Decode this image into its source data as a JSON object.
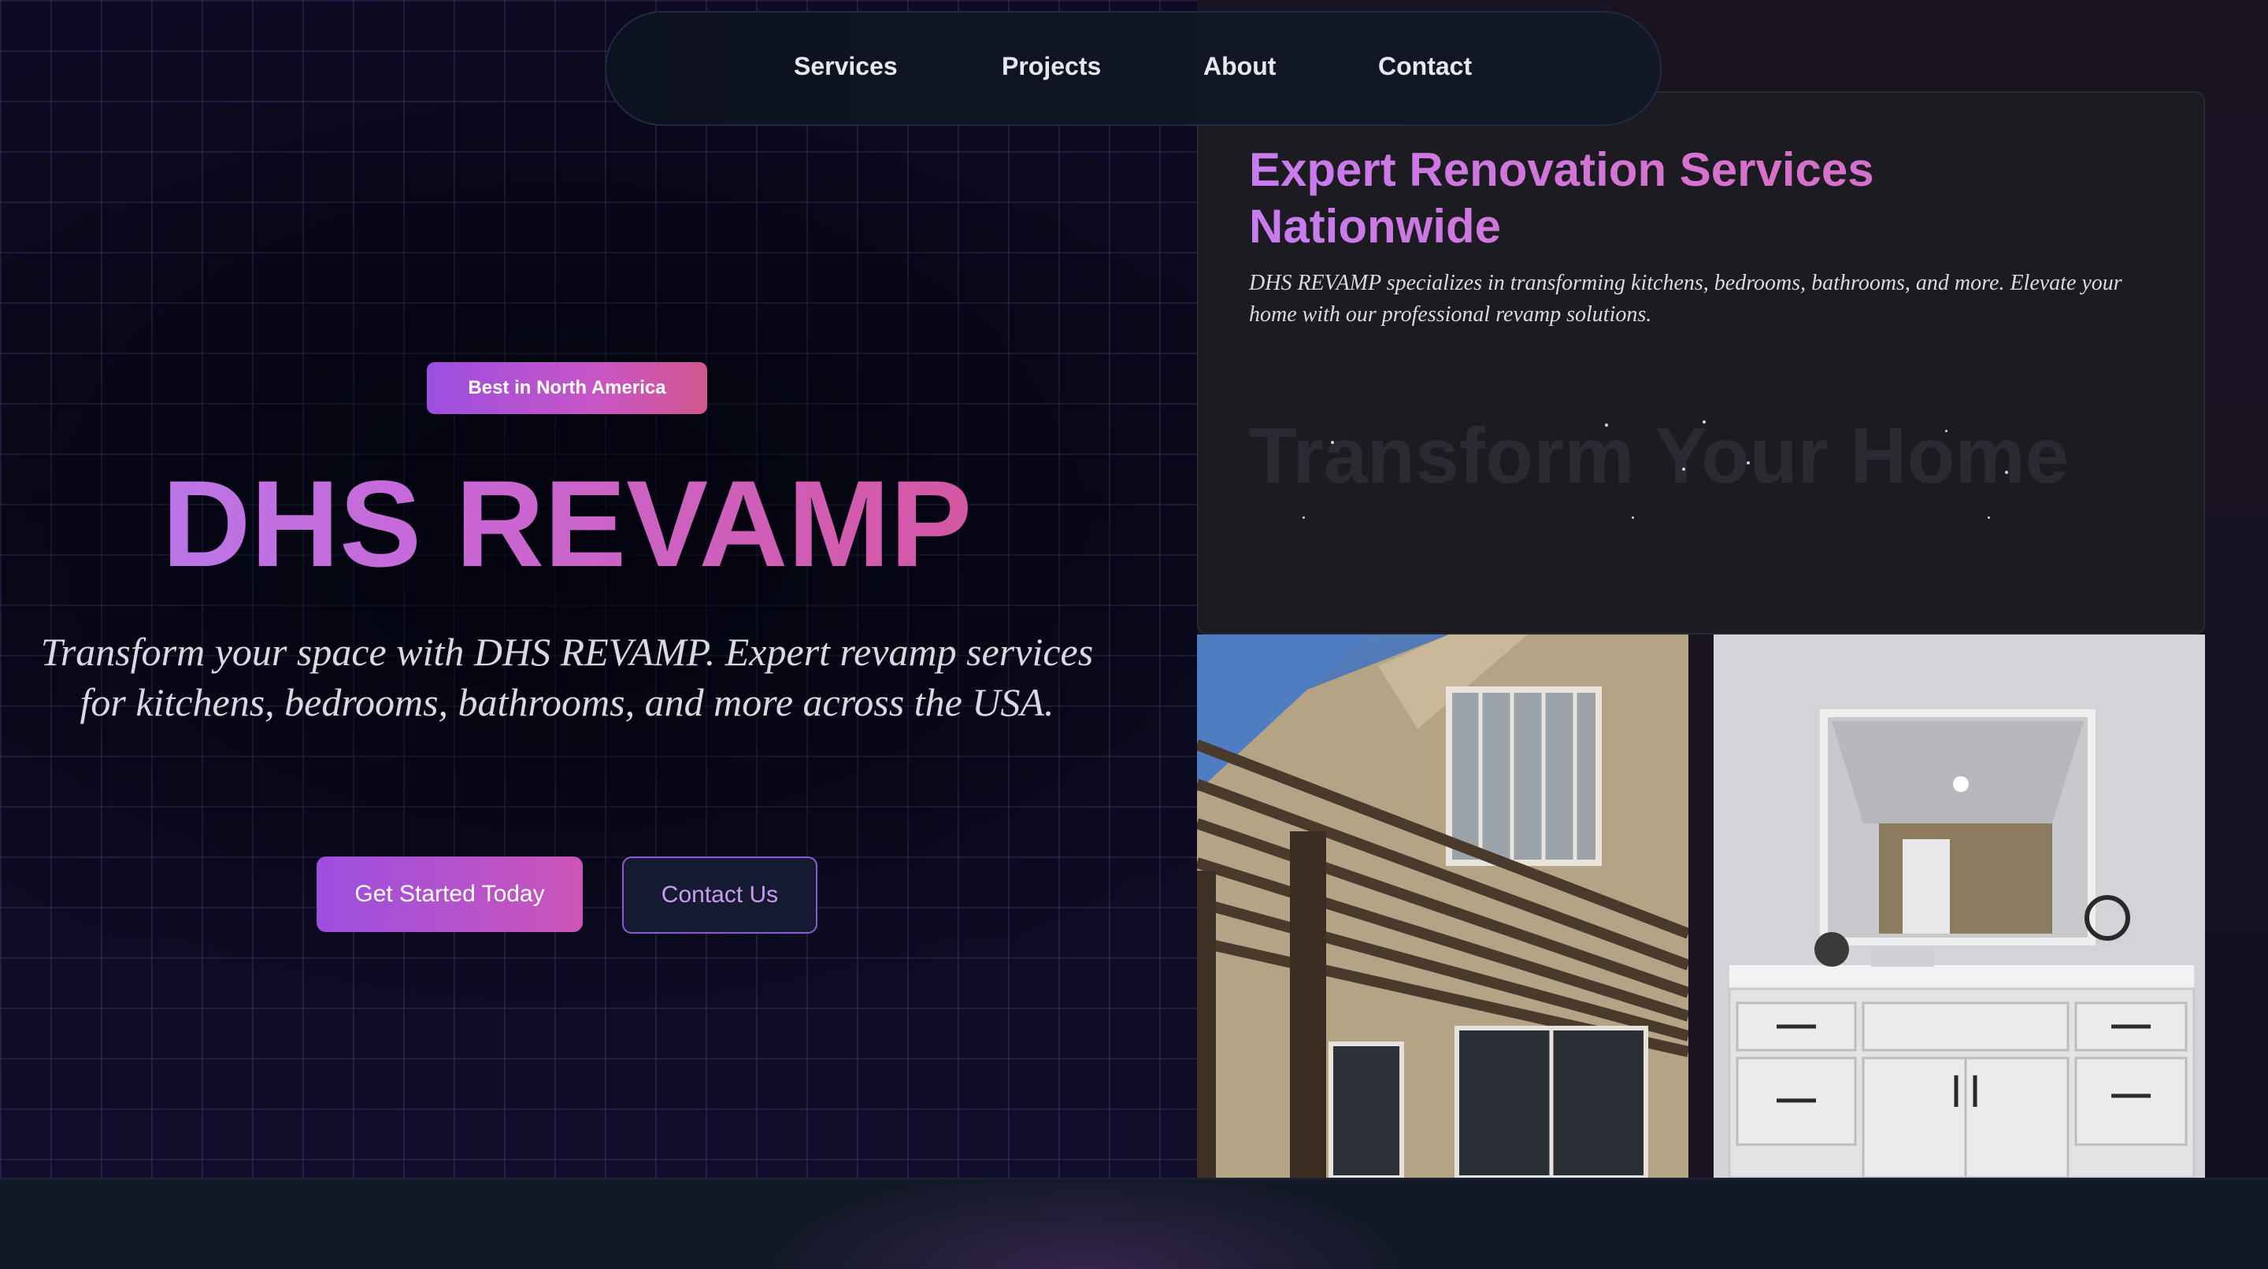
{
  "nav": {
    "items": [
      {
        "label": "Services"
      },
      {
        "label": "Projects"
      },
      {
        "label": "About"
      },
      {
        "label": "Contact"
      }
    ]
  },
  "hero": {
    "badge": "Best in North America",
    "title": "DHS REVAMP",
    "subtitle": "Transform your space with DHS REVAMP. Expert revamp services for kitchens, bedrooms, bathrooms, and more across the USA.",
    "primary_cta": "Get Started Today",
    "secondary_cta": "Contact Us"
  },
  "info": {
    "title": "Expert Renovation Services Nationwide",
    "description": "DHS REVAMP specializes in transforming kitchens, bedrooms, bathrooms, and more. Elevate your home with our professional revamp solutions.",
    "animated_heading": "Transform Your Home"
  },
  "gallery": {
    "photos": [
      {
        "subject": "patio pergola"
      },
      {
        "subject": "bathroom vanity"
      }
    ]
  },
  "colors": {
    "accent_purple": "#9b4fe0",
    "accent_pink": "#d85392",
    "card_bg": "#1c1b21",
    "nav_bg": "#0d1220"
  }
}
